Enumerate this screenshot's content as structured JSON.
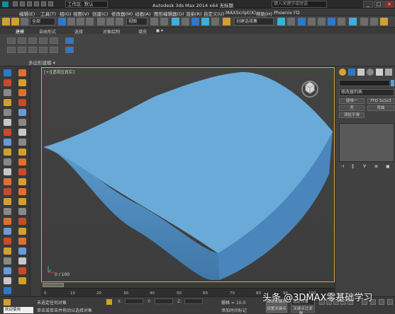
{
  "titlebar": {
    "workspace": "工作区: 默认",
    "app_title": "Autodesk 3ds Max  2014 x64      无标题",
    "search_placeholder": "键入关键字或短语",
    "controls": [
      "_",
      "□",
      "×"
    ]
  },
  "menu": [
    "编辑(E)",
    "工具(T)",
    "组(G)",
    "视图(V)",
    "创建(C)",
    "修改器(M)",
    "动画(A)",
    "图形编辑器(D)",
    "渲染(R)",
    "自定义(U)",
    "MAXScript(X)",
    "帮助(H)",
    "Phoenix FD"
  ],
  "toolbar": {
    "filter_dropdown": "全部",
    "view_dropdown": "视图",
    "selection_set": "创建选择集"
  },
  "ribbon": {
    "tabs": [
      "建模",
      "自由形式",
      "选择",
      "对象绘制",
      "填充"
    ],
    "panel_label": "多边形建模 ▾"
  },
  "viewport": {
    "label": "[+][透视][真实]",
    "frame_counter": "0 / 100"
  },
  "command_panel": {
    "modifier_list": "修改器列表",
    "buttons": [
      "使唯一",
      "FFD 3x3x3",
      "壳",
      "弯曲",
      "涡轮平滑"
    ],
    "stack_tools": [
      "⊣",
      "‖",
      "∀",
      "⊗",
      "▣"
    ]
  },
  "timeline": {
    "ticks": [
      "0",
      "10",
      "20",
      "30",
      "40",
      "50",
      "60",
      "70",
      "80",
      "90",
      "100"
    ]
  },
  "status": {
    "welcome": "欢迎使用 MAXSc",
    "line1": "未选定任何对象",
    "line2": "单击或单击并拖动以选择对象",
    "x_label": "X:",
    "y_label": "Y:",
    "z_label": "Z:",
    "grid": "栅格 = 10.0",
    "add_tag": "添加时间标记",
    "auto_key": "自动关键点",
    "set_key": "设置关键点",
    "selection": "选定对象",
    "key_filters": "关键点过滤器..."
  },
  "watermark": "头条 @3DMAX零基础学习",
  "colors": {
    "model": "#6aaad8",
    "viewport_border": "#d7a94a",
    "accent_blue": "#2f78c8"
  }
}
